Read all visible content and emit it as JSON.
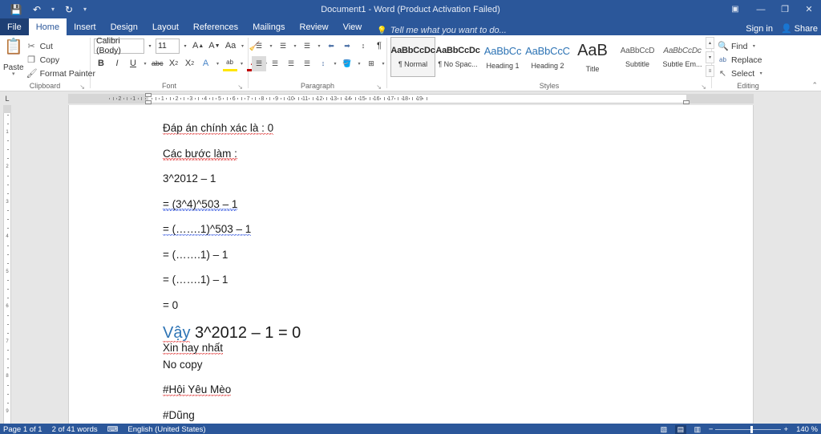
{
  "window": {
    "title": "Document1 - Word (Product Activation Failed)",
    "quick_access": [
      {
        "name": "save-icon",
        "glyph": "💾"
      },
      {
        "name": "undo-icon",
        "glyph": "↶"
      },
      {
        "name": "undo-dropdown-icon",
        "glyph": "▾"
      },
      {
        "name": "redo-icon",
        "glyph": "↻"
      },
      {
        "name": "customize-qat-icon",
        "glyph": "▾"
      }
    ],
    "controls": [
      {
        "name": "ribbon-display-options",
        "glyph": "▣"
      },
      {
        "name": "minimize-button",
        "glyph": "—"
      },
      {
        "name": "restore-button",
        "glyph": "❐"
      },
      {
        "name": "close-button",
        "glyph": "✕"
      }
    ],
    "sign_in": "Sign in",
    "share": "Share",
    "share_icon": "👤"
  },
  "tabs": [
    {
      "label": "File",
      "active": false,
      "file": true
    },
    {
      "label": "Home",
      "active": true,
      "file": false
    },
    {
      "label": "Insert",
      "active": false,
      "file": false
    },
    {
      "label": "Design",
      "active": false,
      "file": false
    },
    {
      "label": "Layout",
      "active": false,
      "file": false
    },
    {
      "label": "References",
      "active": false,
      "file": false
    },
    {
      "label": "Mailings",
      "active": false,
      "file": false
    },
    {
      "label": "Review",
      "active": false,
      "file": false
    },
    {
      "label": "View",
      "active": false,
      "file": false
    }
  ],
  "tell_me": {
    "placeholder": "Tell me what you want to do...",
    "icon": "💡"
  },
  "ribbon": {
    "collapse_icon": "⌃",
    "clipboard": {
      "label": "Clipboard",
      "dialog_launcher": "↘",
      "paste": {
        "label": "Paste",
        "icon": "📋",
        "caret": "▾"
      },
      "items": [
        {
          "label": "Cut",
          "icon": "✂"
        },
        {
          "label": "Copy",
          "icon": "❐"
        },
        {
          "label": "Format Painter",
          "icon": "🖌"
        }
      ]
    },
    "font": {
      "label": "Font",
      "dialog_launcher": "↘",
      "font_name": "Calibri (Body)",
      "font_size": "11",
      "grow_font": "A",
      "shrink_font": "A",
      "change_case": "Aa",
      "clear_formatting": "🧹",
      "bold": "B",
      "italic": "I",
      "underline": "U",
      "strikethrough": "abc",
      "subscript": "X",
      "superscript": "X",
      "text_effects": "A",
      "highlight": "ab",
      "font_color": "A"
    },
    "paragraph": {
      "label": "Paragraph",
      "dialog_launcher": "↘",
      "bullets": "☰",
      "numbering": "☰",
      "multilevel": "☰",
      "decrease_indent": "⬅",
      "increase_indent": "➡",
      "sort": "↕",
      "show_marks": "¶",
      "align_left": "☰",
      "align_center": "☰",
      "align_right": "☰",
      "justify": "☰",
      "line_spacing": "↕",
      "shading": "🪣",
      "borders": "⊞"
    },
    "styles": {
      "label": "Styles",
      "dialog_launcher": "↘",
      "scroll_up": "▴",
      "scroll_down": "▾",
      "more": "≡",
      "items": [
        {
          "preview": "AaBbCcDc",
          "name": "¶ Normal",
          "selected": true,
          "kind": "normal"
        },
        {
          "preview": "AaBbCcDc",
          "name": "¶ No Spac...",
          "selected": false,
          "kind": "normal"
        },
        {
          "preview": "AaBbCc",
          "name": "Heading 1",
          "selected": false,
          "kind": "h1"
        },
        {
          "preview": "AaBbCcC",
          "name": "Heading 2",
          "selected": false,
          "kind": "h2"
        },
        {
          "preview": "AaB",
          "name": "Title",
          "selected": false,
          "kind": "title"
        },
        {
          "preview": "AaBbCcD",
          "name": "Subtitle",
          "selected": false,
          "kind": "sub"
        },
        {
          "preview": "AaBbCcDc",
          "name": "Subtle Em...",
          "selected": false,
          "kind": "em"
        }
      ]
    },
    "editing": {
      "label": "Editing",
      "items": [
        {
          "label": "Find",
          "icon": "🔍",
          "caret": "▾"
        },
        {
          "label": "Replace",
          "icon": "ab",
          "caret": ""
        },
        {
          "label": "Select",
          "icon": "↖",
          "caret": "▾"
        }
      ]
    }
  },
  "ruler": {
    "tab_selector_icon": "L",
    "horizontal_ticks": [
      "2",
      "1",
      "1",
      "2",
      "3",
      "4",
      "5",
      "6",
      "7",
      "8",
      "9",
      "10",
      "11",
      "12",
      "13",
      "14",
      "15",
      "16",
      "17",
      "18",
      "19"
    ],
    "vertical_ticks": [
      "1",
      "2",
      "3",
      "4",
      "5",
      "6",
      "7",
      "8",
      "9"
    ]
  },
  "document": {
    "paragraphs": [
      {
        "text": "Đáp án chính xác là : 0",
        "style": "body",
        "spell": "red"
      },
      {
        "text": "Các bước làm :",
        "style": "body",
        "spell": "red"
      },
      {
        "text": "3^2012 – 1",
        "style": "body",
        "spell": "none"
      },
      {
        "text": "= (3^4)^503 – 1",
        "style": "body",
        "spell": "blue"
      },
      {
        "text": "= (…….1)^503 – 1",
        "style": "body",
        "spell": "blue"
      },
      {
        "text": "= (…….1) – 1",
        "style": "body",
        "spell": "none"
      },
      {
        "text": "= (…….1) – 1",
        "style": "body",
        "spell": "none"
      },
      {
        "text": "= 0",
        "style": "body",
        "spell": "none"
      }
    ],
    "heading": {
      "blue_word": "Vậy",
      "rest": " 3^2012 – 1 = 0"
    },
    "tail_paragraphs": [
      {
        "text": "Xin hay nhất",
        "style": "body",
        "spell": "red"
      },
      {
        "text": "No copy",
        "style": "body",
        "spell": "none"
      },
      {
        "text": "#Hội Yêu Mèo",
        "style": "body",
        "spell": "red"
      },
      {
        "text": "#Dũng",
        "style": "body",
        "spell": "none"
      }
    ]
  },
  "status_bar": {
    "page": "Page 1 of 1",
    "words": "2 of 41 words",
    "proofing_icon": "⌨",
    "language": "English (United States)",
    "views": [
      {
        "name": "read-mode-view",
        "glyph": "▧",
        "active": false
      },
      {
        "name": "print-layout-view",
        "glyph": "▤",
        "active": true
      },
      {
        "name": "web-layout-view",
        "glyph": "▥",
        "active": false
      }
    ],
    "zoom_out": "−",
    "zoom_in": "+",
    "zoom_level": "140 %"
  },
  "colors": {
    "accent": "#2b579a",
    "accent_dark": "#1e3f74",
    "heading_blue": "#2e74b5",
    "spell_red": "#e03a3a",
    "spell_blue": "#3a5ce0",
    "page_bg": "#e6e6e6"
  }
}
